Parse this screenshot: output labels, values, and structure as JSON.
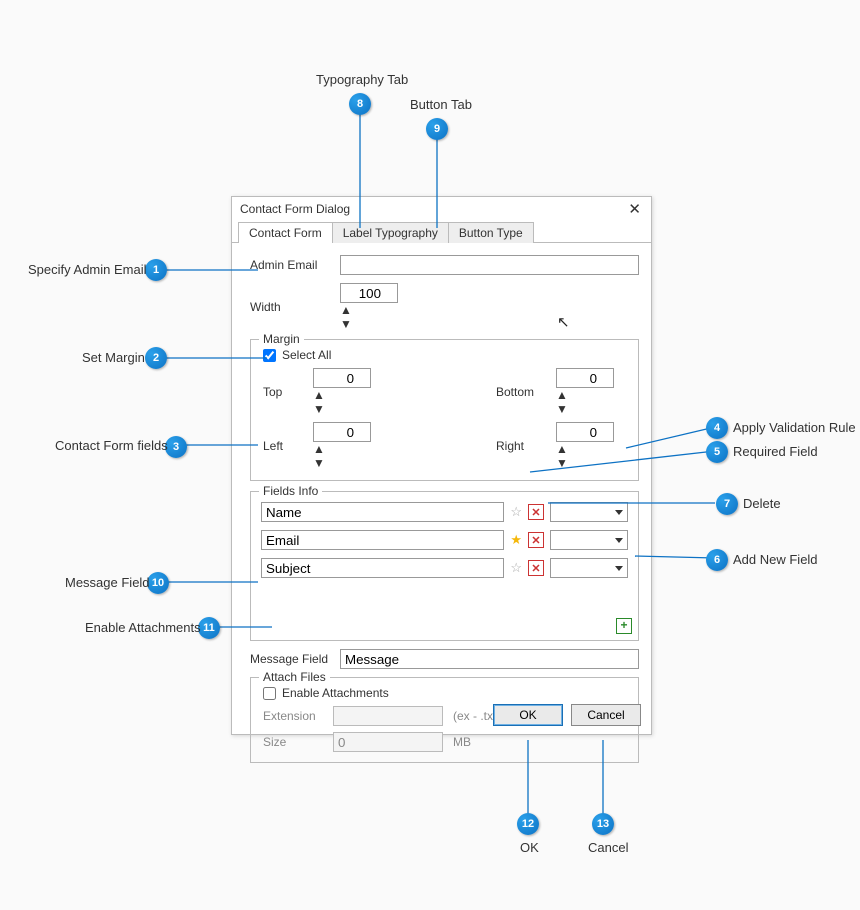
{
  "dialog": {
    "title": "Contact Form Dialog",
    "tabs": [
      "Contact Form",
      "Label Typography",
      "Button Type"
    ],
    "active_tab": 0,
    "admin_email_label": "Admin Email",
    "admin_email_value": "",
    "width_label": "Width",
    "width_value": "100",
    "margin": {
      "title": "Margin",
      "select_all_label": "Select All",
      "select_all_checked": true,
      "top_label": "Top",
      "top_value": "0",
      "left_label": "Left",
      "left_value": "0",
      "bottom_label": "Bottom",
      "bottom_value": "0",
      "right_label": "Right",
      "right_value": "0"
    },
    "fields": {
      "title": "Fields Info",
      "rows": [
        {
          "name": "Name",
          "required": false,
          "validation": ""
        },
        {
          "name": "Email",
          "required": true,
          "validation": ""
        },
        {
          "name": "Subject",
          "required": false,
          "validation": ""
        }
      ]
    },
    "message": {
      "label": "Message Field",
      "value": "Message"
    },
    "attach": {
      "title": "Attach Files",
      "enable_label": "Enable Attachments",
      "enable_checked": false,
      "ext_label": "Extension",
      "ext_value": "",
      "ext_hint": "(ex - .txt,.pdf,.doc)",
      "size_label": "Size",
      "size_value": "0",
      "size_unit": "MB"
    },
    "ok_label": "OK",
    "cancel_label": "Cancel"
  },
  "callouts": [
    {
      "num": "1",
      "text": "Specify Admin Email",
      "side": "left"
    },
    {
      "num": "2",
      "text": "Set Margin",
      "side": "left"
    },
    {
      "num": "3",
      "text": "Contact Form fields",
      "side": "left"
    },
    {
      "num": "4",
      "text": "Apply Validation Rule",
      "side": "right"
    },
    {
      "num": "5",
      "text": "Required Field",
      "side": "right"
    },
    {
      "num": "6",
      "text": "Add New Field",
      "side": "right"
    },
    {
      "num": "7",
      "text": "Delete",
      "side": "right"
    },
    {
      "num": "8",
      "text": "Typography Tab",
      "side": "top"
    },
    {
      "num": "9",
      "text": "Button Tab",
      "side": "top"
    },
    {
      "num": "10",
      "text": "Message Field",
      "side": "left"
    },
    {
      "num": "11",
      "text": "Enable Attachments",
      "side": "left"
    },
    {
      "num": "12",
      "text": "OK",
      "side": "bottom"
    },
    {
      "num": "13",
      "text": "Cancel",
      "side": "bottom"
    }
  ]
}
